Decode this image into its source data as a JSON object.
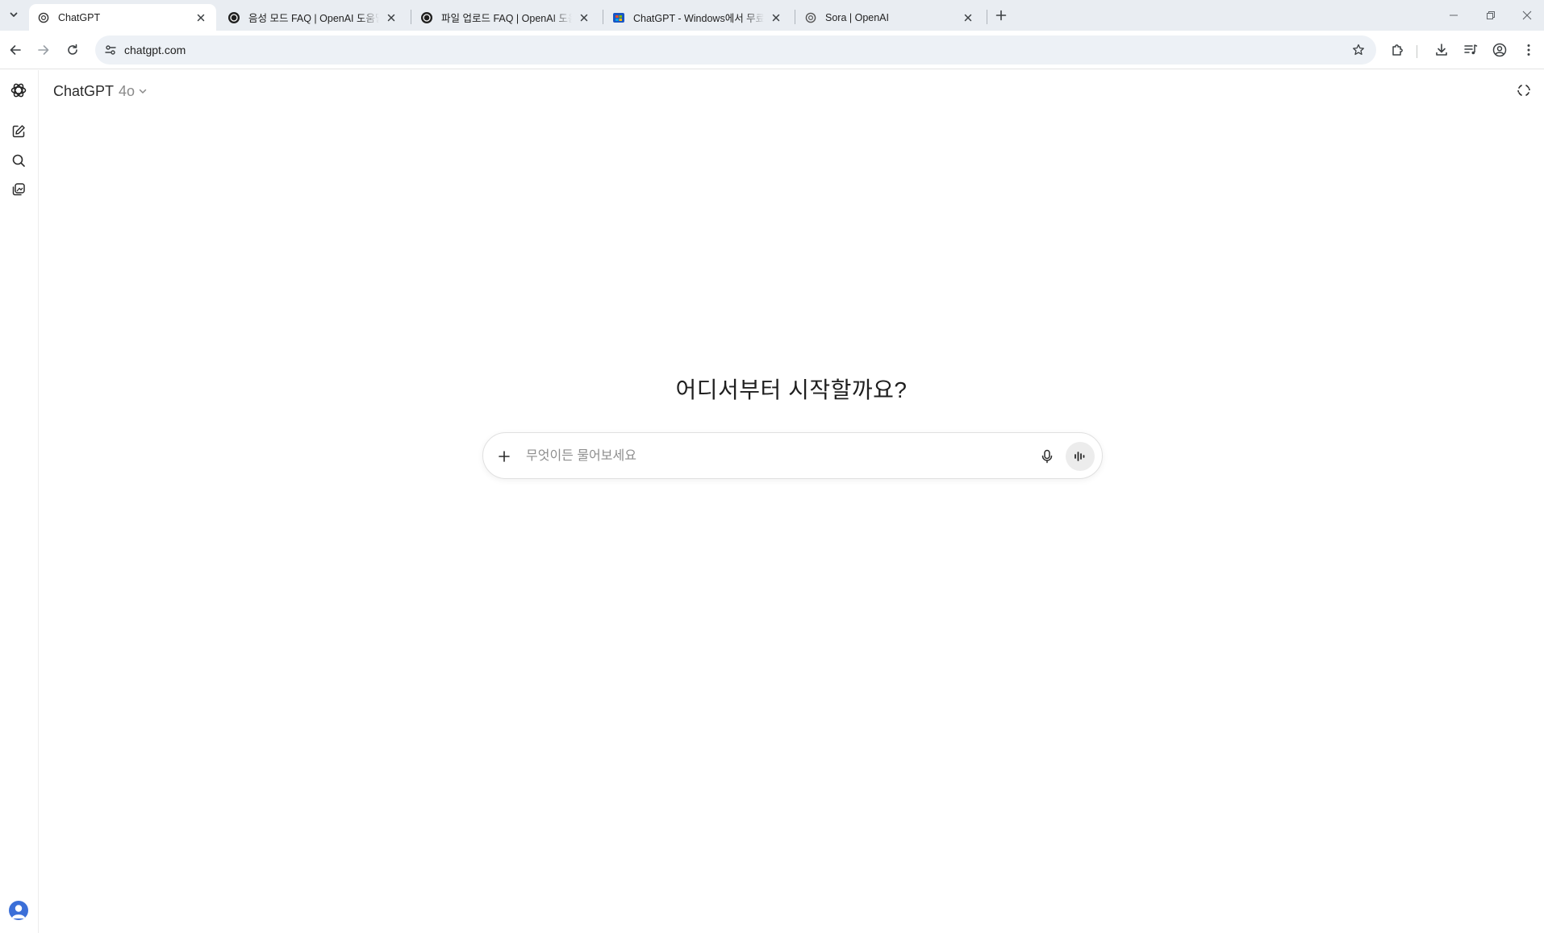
{
  "browser": {
    "tabs": [
      {
        "title": "ChatGPT",
        "favicon": "openai-icon",
        "active": true
      },
      {
        "title": "음성 모드 FAQ | OpenAI 도움말",
        "favicon": "openai-icon",
        "active": false
      },
      {
        "title": "파일 업로드 FAQ | OpenAI 도움말",
        "favicon": "openai-icon",
        "active": false
      },
      {
        "title": "ChatGPT - Windows에서 무료",
        "favicon": "microsoft-store-icon",
        "active": false
      },
      {
        "title": "Sora | OpenAI",
        "favicon": "openai-icon",
        "active": false
      }
    ],
    "url": "chatgpt.com"
  },
  "header": {
    "model_name": "ChatGPT",
    "model_version": "4o"
  },
  "main": {
    "headline": "어디서부터 시작할까요?",
    "composer": {
      "placeholder": "무엇이든 물어보세요",
      "value": ""
    }
  },
  "sidebar": {
    "items": [
      "openai-logo-icon",
      "new-chat-icon",
      "search-icon",
      "library-icon",
      "avatar"
    ]
  }
}
